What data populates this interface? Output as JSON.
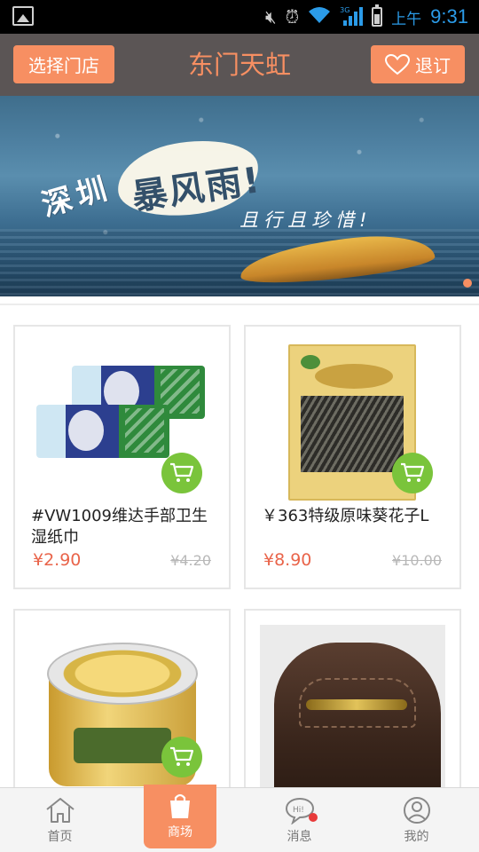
{
  "status_bar": {
    "ampm": "上午",
    "time": "9:31",
    "network_tag": "3G"
  },
  "header": {
    "left_button": "选择门店",
    "title": "东门天虹",
    "right_button": "退订"
  },
  "banner": {
    "text_line1": "深圳",
    "text_line2": "暴风雨!",
    "text_line3": "且行且珍惜!"
  },
  "products": [
    {
      "name": "#VW1009维达手部卫生湿纸巾",
      "price": "¥2.90",
      "original_price": "¥4.20"
    },
    {
      "name": "￥363特级原味葵花子L",
      "price": "¥8.90",
      "original_price": "¥10.00"
    },
    {
      "name": "",
      "price": "",
      "original_price": ""
    },
    {
      "name": "",
      "price": "",
      "original_price": ""
    }
  ],
  "bottom_nav": [
    {
      "label": "首页",
      "icon": "home-icon"
    },
    {
      "label": "商场",
      "icon": "shopping-bag-icon",
      "active": true
    },
    {
      "label": "消息",
      "icon": "message-icon"
    },
    {
      "label": "我的",
      "icon": "profile-icon"
    }
  ],
  "colors": {
    "accent": "#f78f62",
    "header_bg": "#5b5555",
    "price": "#e9644a",
    "cart_green": "#7ac43b"
  }
}
